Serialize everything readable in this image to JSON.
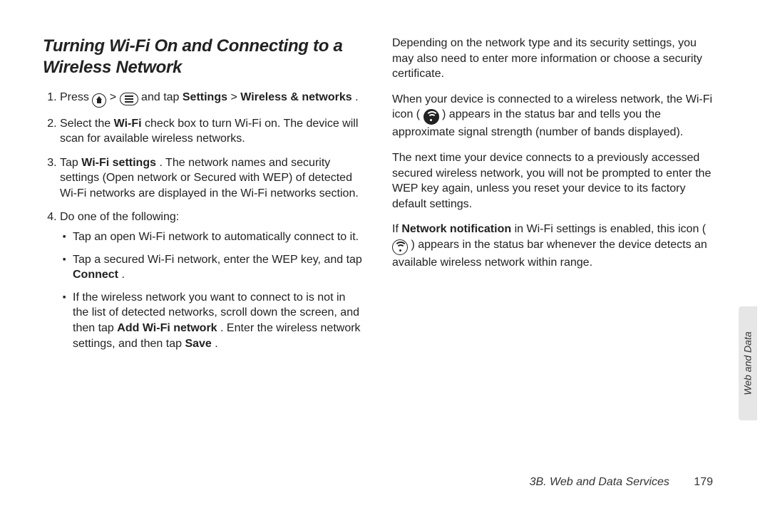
{
  "heading": "Turning Wi-Fi On and Connecting to a Wireless Network",
  "steps": {
    "s1_a": "Press ",
    "s1_b": " > ",
    "s1_c": " and tap ",
    "s1_settings": "Settings",
    "s1_d": " > ",
    "s1_wireless": "Wireless & networks",
    "s1_e": ".",
    "s2_a": "Select the ",
    "s2_wifi": "Wi-Fi",
    "s2_b": " check box to turn Wi-Fi on. The device will scan for available wireless networks.",
    "s3_a": "Tap ",
    "s3_wifiset": "Wi-Fi settings",
    "s3_b": ". The network names and security settings (Open network or Secured with WEP) of detected Wi-Fi networks are displayed in the Wi-Fi networks section.",
    "s4": "Do one of the following:",
    "s4_1": "Tap an open Wi-Fi network to automatically connect to it.",
    "s4_2a": "Tap a secured Wi-Fi network, enter the WEP key, and tap ",
    "s4_2_connect": "Connect",
    "s4_2b": ".",
    "s4_3a": "If the wireless network you want to connect to is not in the list of detected networks, scroll down the screen, and then tap ",
    "s4_3_add": "Add Wi-Fi network",
    "s4_3b": ". Enter the wireless network settings, and then tap ",
    "s4_3_save": "Save",
    "s4_3c": "."
  },
  "right": {
    "p1": "Depending on the network type and its security settings, you may also need to enter more information or choose a security certificate.",
    "p2a": "When your device is connected to a wireless network, the Wi-Fi icon ( ",
    "p2b": " ) appears in the status bar and tells you the approximate signal strength (number of bands displayed).",
    "p3": "The next time your device connects to a previously accessed secured wireless network, you will not be prompted to enter the WEP key again, unless you reset your device to its factory default settings.",
    "p4a": "If ",
    "p4_nn": "Network notification",
    "p4b": " in Wi-Fi settings is enabled, this icon ( ",
    "p4c": " ) appears in the status bar whenever the device detects an available wireless network within range."
  },
  "sideTab": "Web and Data",
  "footer": {
    "section": "3B. Web and Data Services",
    "page": "179"
  }
}
